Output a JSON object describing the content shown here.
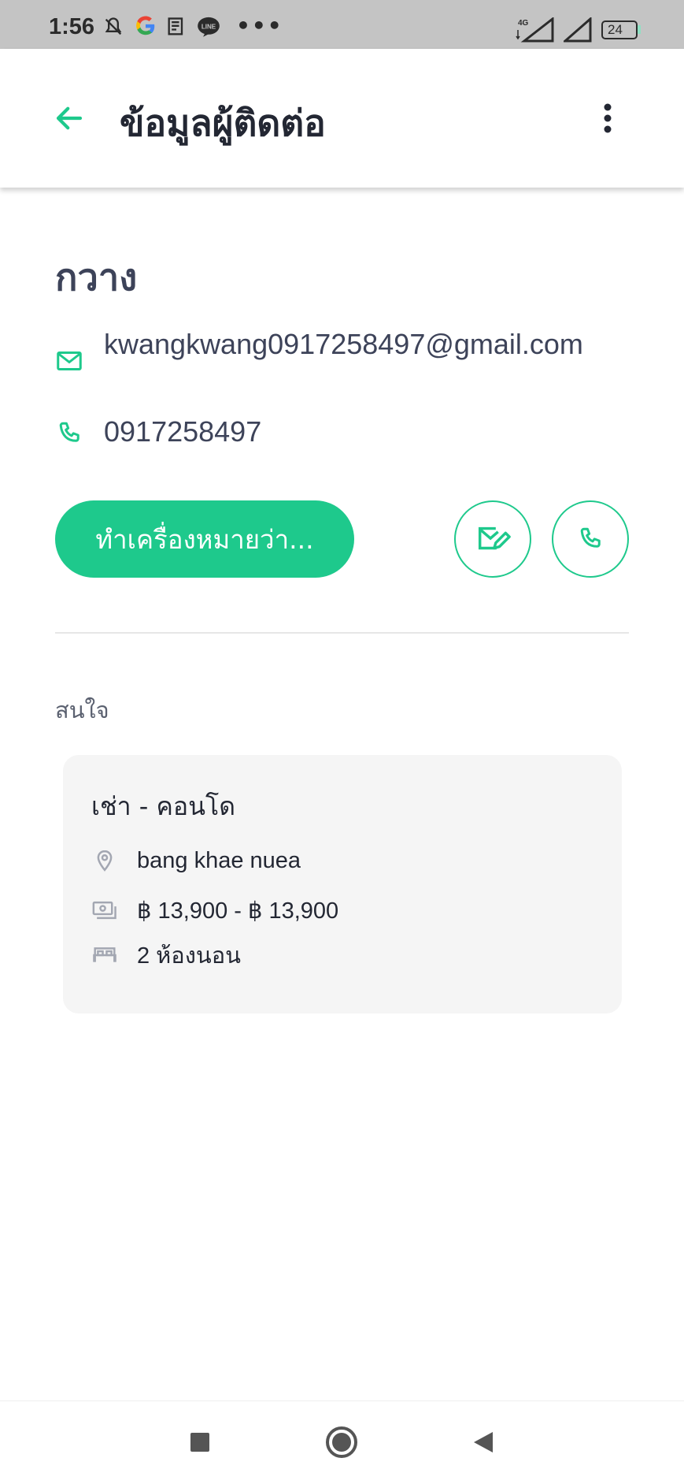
{
  "status_bar": {
    "time": "1:56",
    "network": "4G",
    "battery": "24"
  },
  "app_bar": {
    "title": "ข้อมูลผู้ติดต่อ"
  },
  "contact": {
    "name": "กวาง",
    "email": "kwangkwang0917258497@gmail.com",
    "phone": "0917258497"
  },
  "actions": {
    "primary_label": "ทำเครื่องหมายว่า..."
  },
  "interest": {
    "section_title": "สนใจ",
    "card": {
      "title": "เช่า - คอนโด",
      "location": "bang khae nuea",
      "price": "฿ 13,900 - ฿ 13,900",
      "bedrooms": "2 ห้องนอน"
    }
  },
  "icons": {
    "back": "arrow-left-icon",
    "more": "more-vert-icon",
    "email": "mail-icon",
    "phone": "phone-icon",
    "compose_email": "mail-edit-icon",
    "location": "location-pin-icon",
    "price": "cash-icon",
    "bed": "bed-icon"
  },
  "colors": {
    "accent": "#1ec98c",
    "text_primary": "#3d4359",
    "card_bg": "#f5f5f5",
    "status_bar_bg": "#c4c4c4"
  }
}
